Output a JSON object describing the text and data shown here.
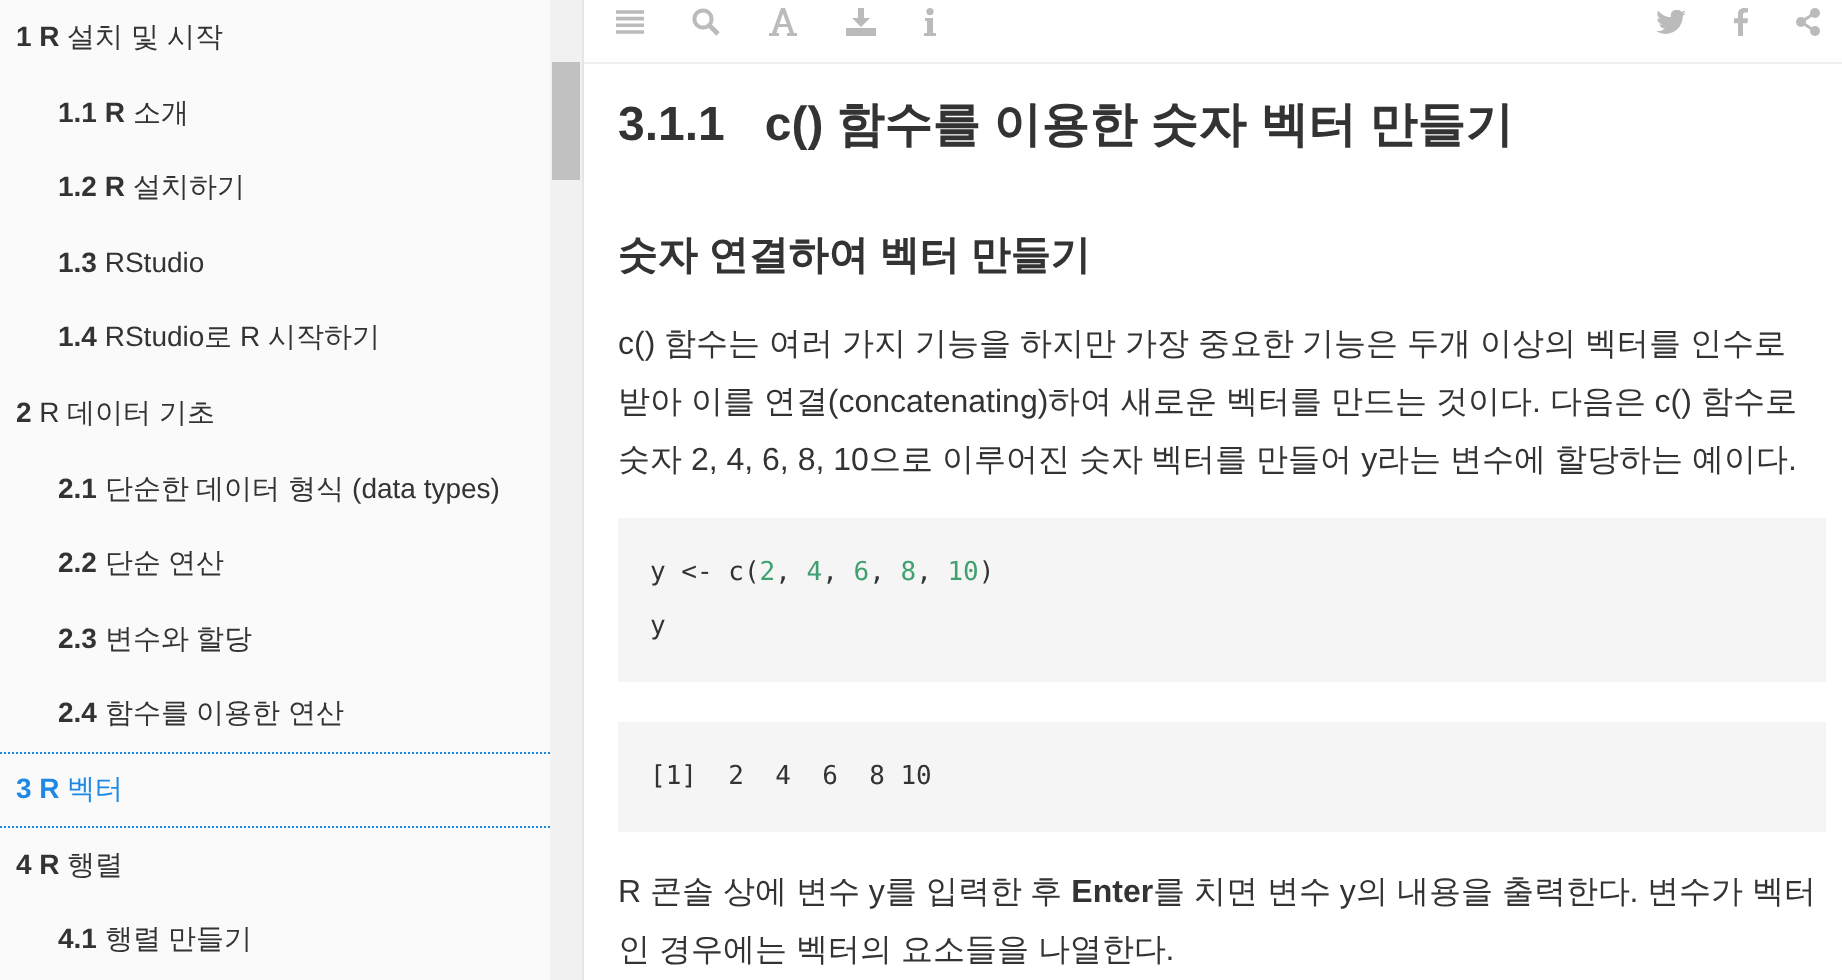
{
  "sidebar": {
    "items": [
      {
        "label": "**1 R** 설치 및 시작",
        "selected": false,
        "children": [
          {
            "label": "**1.1 R** 소개",
            "selected": false
          },
          {
            "label": "**1.2 R** 설치하기",
            "selected": false
          },
          {
            "label": "**1.3** RStudio",
            "selected": false
          },
          {
            "label": "**1.4** RStudio로 R 시작하기",
            "selected": false
          }
        ]
      },
      {
        "label": "**2** R 데이터 기초",
        "selected": false,
        "children": [
          {
            "label": "**2.1** 단순한 데이터 형식 (data types)",
            "selected": false
          },
          {
            "label": "**2.2** 단순 연산",
            "selected": false
          },
          {
            "label": "**2.3** 변수와 할당",
            "selected": false
          },
          {
            "label": "**2.4** 함수를 이용한 연산",
            "selected": false
          }
        ]
      },
      {
        "label": "**3 R** 벡터",
        "selected": true
      },
      {
        "label": "**4 R** 행렬",
        "selected": false,
        "children": [
          {
            "label": "**4.1** 행렬 만들기",
            "selected": false
          }
        ]
      }
    ]
  },
  "content": {
    "heading_number": "3.1.1",
    "heading": "c() 함수를 이용한 숫자 벡터 만들기",
    "subheading": "숫자 연결하여 벡터 만들기",
    "paragraphs_before": [
      "c() 함수는 여러 가지 기능을 하지만 가장 중요한 기능은 두개 이상의 벡터를 인수로 받아 이를 연결(concatenating)하여 새로운 벡터를 만드는 것이다. 다음은 c() 함수로 숫자 2, 4, 6, 8, 10으로 이루어진 숫자 벡터를 만들어 y라는 변수에 할당하는 예이다."
    ],
    "code_blocks": [
      {
        "lines": [
          [
            {
              "text": "y <- c(",
              "kind": "plain"
            },
            {
              "text": "2",
              "kind": "number"
            },
            {
              "text": ", ",
              "kind": "plain"
            },
            {
              "text": "4",
              "kind": "number"
            },
            {
              "text": ", ",
              "kind": "plain"
            },
            {
              "text": "6",
              "kind": "number"
            },
            {
              "text": ", ",
              "kind": "plain"
            },
            {
              "text": "8",
              "kind": "number"
            },
            {
              "text": ", ",
              "kind": "plain"
            },
            {
              "text": "10",
              "kind": "number"
            },
            {
              "text": ")",
              "kind": "plain"
            }
          ],
          [
            {
              "text": "y",
              "kind": "plain"
            }
          ]
        ]
      },
      {
        "lines": [
          [
            {
              "text": "[1]  2  4  6  8 10",
              "kind": "plain"
            }
          ]
        ]
      }
    ],
    "paragraphs_after": [
      "R 콘솔 상에 변수 y를 입력한 후 **Enter**를 치면 변수 y의 내용을 출력한다. 변수가 벡터인 경우에는 벡터의 요소들을 나열한다."
    ]
  }
}
